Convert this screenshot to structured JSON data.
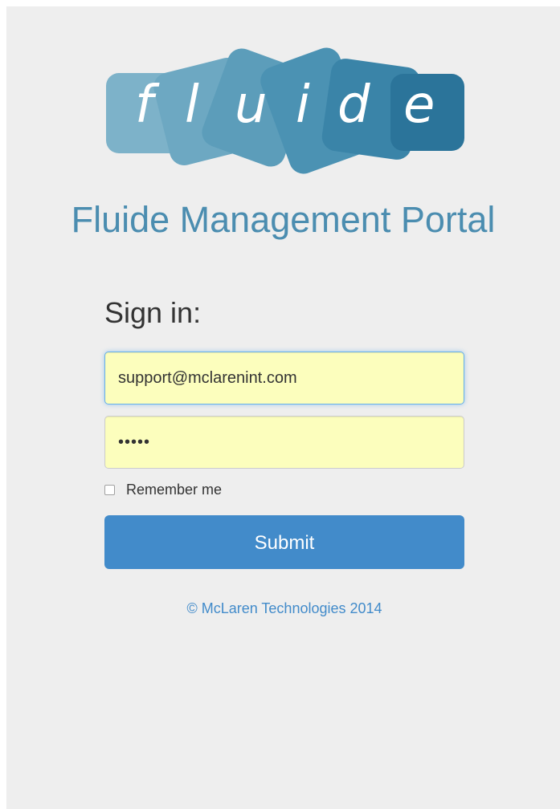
{
  "brand": {
    "logo_text": "fluide",
    "logo_letters": [
      "f",
      "l",
      "u",
      "i",
      "d",
      "e"
    ],
    "portal_title": "Fluide Management Portal"
  },
  "signin": {
    "heading": "Sign in:",
    "email_value": "support@mclarenint.com",
    "password_value": "•••••",
    "remember_label": "Remember me",
    "remember_checked": false,
    "submit_label": "Submit"
  },
  "footer": {
    "copyright": "© McLaren Technologies 2014"
  },
  "colors": {
    "page_background": "#eeeeee",
    "title": "#4b8db0",
    "field_autofill_background": "#fcfebd",
    "focus_border": "#66afe9",
    "primary_button": "#428bca",
    "footer_link": "#428bca",
    "logo_tile_light": "#7fb3ca",
    "logo_tile_dark": "#2b749a"
  }
}
